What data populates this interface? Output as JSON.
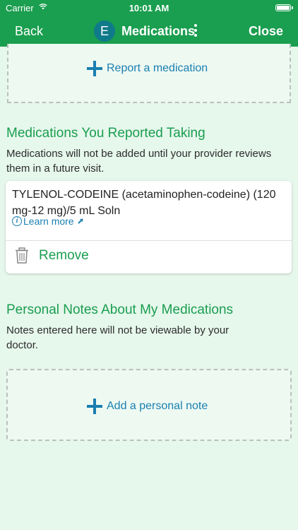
{
  "status_bar": {
    "carrier": "Carrier",
    "time": "10:01 AM"
  },
  "navbar": {
    "back_label": "Back",
    "avatar_letter": "E",
    "title": "Medications",
    "close_label": "Close",
    "accent_color": "#1a9e4f"
  },
  "report_box": {
    "action_label": "Report a medication"
  },
  "reported_section": {
    "title": "Medications You Reported Taking",
    "description": "Medications will not be added until your provider reviews them in a future visit.",
    "medications": [
      {
        "name": "TYLENOL-CODEINE (acetaminophen-codeine) (120 mg-12 mg)/5 mL Soln",
        "learn_more_label": "Learn more",
        "remove_label": "Remove"
      }
    ]
  },
  "notes_section": {
    "title": "Personal Notes About My Medications",
    "description": "Notes entered here will not be viewable by your doctor.",
    "action_label": "Add a personal note"
  },
  "icons": [
    "wifi-icon",
    "battery-icon",
    "kebab-menu-icon",
    "plus-icon",
    "info-icon",
    "external-link-icon",
    "trash-icon"
  ]
}
